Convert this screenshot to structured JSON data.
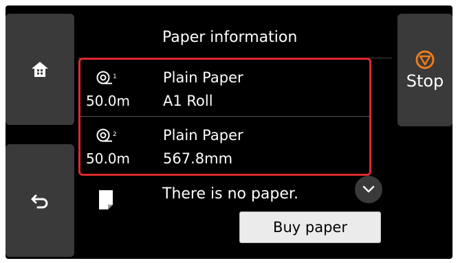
{
  "screen": {
    "title": "Paper information",
    "stop_label": "Stop",
    "accent": "#e0292b",
    "stop_color": "#f07c1a"
  },
  "rolls": [
    {
      "icon": "roll-1-icon",
      "length": "50.0m",
      "type": "Plain Paper",
      "size": "A1 Roll"
    },
    {
      "icon": "roll-2-icon",
      "length": "50.0m",
      "type": "Plain Paper",
      "size": "567.8mm"
    }
  ],
  "sheet": {
    "icon": "sheet-paper-icon",
    "status": "There is no paper."
  },
  "buy_label": "Buy paper",
  "icons": {
    "home": "home-icon",
    "back": "back-arrow-icon",
    "stop": "stop-icon",
    "more": "chevron-down-icon"
  }
}
